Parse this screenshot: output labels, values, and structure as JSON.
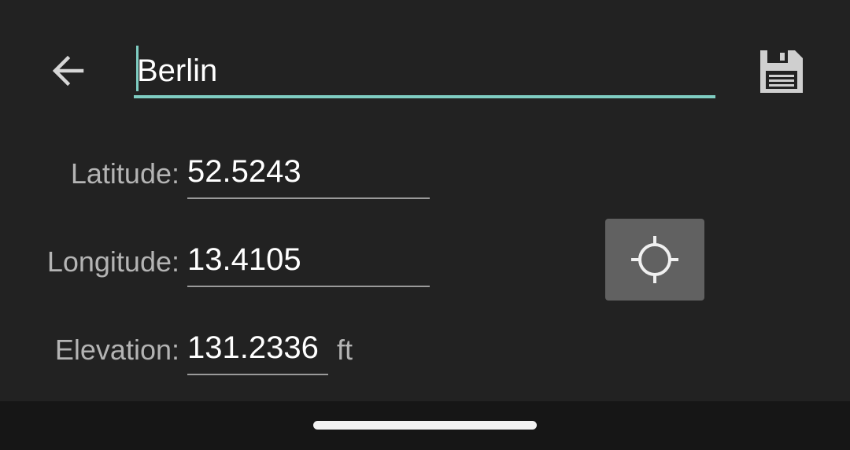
{
  "header": {
    "back_icon": "arrow-back-icon",
    "location_name": "Berlin",
    "save_icon": "floppy-disk-save-icon",
    "accent_color": "#7fcdc2"
  },
  "form": {
    "latitude": {
      "label": "Latitude:",
      "value": "52.5243"
    },
    "longitude": {
      "label": "Longitude:",
      "value": "13.4105"
    },
    "elevation": {
      "label": "Elevation:",
      "value": "131.2336",
      "unit": "ft"
    }
  },
  "locate_button": {
    "icon": "crosshair-gps-icon",
    "background": "#616161"
  },
  "nav_bar": {
    "handle": "home-gesture-handle"
  }
}
